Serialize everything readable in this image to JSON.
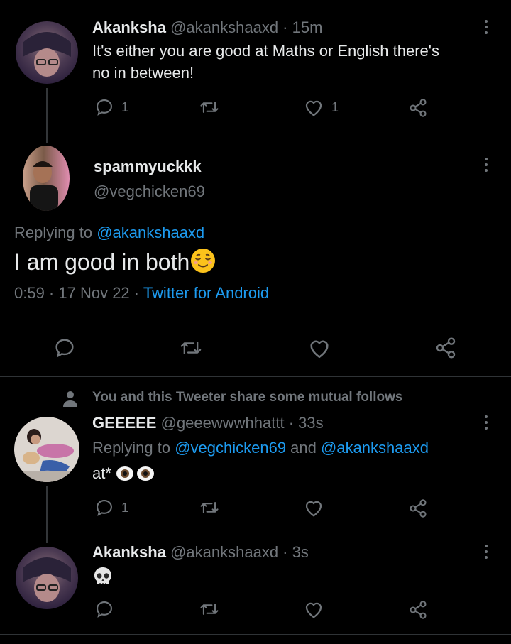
{
  "tweet1": {
    "name": "Akanksha",
    "handle": "@akankshaaxd",
    "time": "15m",
    "text_line1": "It's either you are good at Maths or English there's",
    "text_line2": "no in between!",
    "reply_count": "1",
    "like_count": "1"
  },
  "main": {
    "name": "spammyuckkk",
    "handle": "@vegchicken69",
    "replying_prefix": "Replying to ",
    "replying_to": "@akankshaaxd",
    "text": "I am good in both",
    "timestamp": "0:59 · 17 Nov 22 · ",
    "source": "Twitter for Android"
  },
  "mutual_notice": "You and this Tweeter share some mutual follows",
  "tweet3": {
    "name": "GEEEEE",
    "handle": "@geeewwwhhattt",
    "time": "33s",
    "replying_prefix": "Replying to ",
    "replying_to_1": "@vegchicken69",
    "replying_and": " and ",
    "replying_to_2": "@akankshaaxd",
    "text": "at*",
    "reply_count": "1"
  },
  "tweet4": {
    "name": "Akanksha",
    "handle": "@akankshaaxd",
    "time": "3s"
  },
  "dot_separator": " · ",
  "colors": {
    "background": "#000000",
    "link": "#1d9bf0",
    "muted": "#71767b",
    "text": "#e7e9ea"
  },
  "icons": [
    "reply-icon",
    "retweet-icon",
    "like-icon",
    "share-icon",
    "more-icon",
    "person-icon",
    "skull-emoji",
    "eyes-emoji",
    "relieved-face-emoji"
  ]
}
